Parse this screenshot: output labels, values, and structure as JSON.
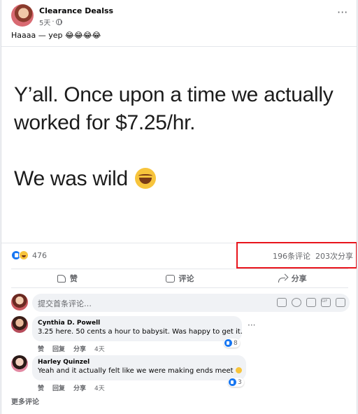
{
  "post": {
    "author": "Clearance Dealss",
    "time": "5天",
    "caption": "Haaaa — yep 😂😂😂😂",
    "image_text": {
      "line1": "Y’all. Once upon a time we actually",
      "line2": "worked for $7.25/hr.",
      "line3": "We was wild"
    }
  },
  "reactions": {
    "count": "476"
  },
  "stats": {
    "comments": "196条评论",
    "shares": "203次分享"
  },
  "actions": {
    "like": "赞",
    "comment": "评论",
    "share": "分享"
  },
  "composer": {
    "placeholder": "提交首条评论…"
  },
  "comments": [
    {
      "name": "Cynthia D. Powell",
      "text": "3.25 here. 50 cents a hour to babysit. Was happy to get it.",
      "like": "赞",
      "reply": "回复",
      "share": "分享",
      "time": "4天",
      "reactions": "8"
    },
    {
      "name": "Harley Quinzel",
      "text": "Yeah and it actually felt like we were making ends meet",
      "like": "赞",
      "reply": "回复",
      "share": "分享",
      "time": "4天",
      "reactions": "3"
    }
  ],
  "more_comments": "更多评论",
  "colors": {
    "brand_blue": "#1877f2",
    "highlight_red": "#e8141c",
    "muted": "#65676b"
  }
}
